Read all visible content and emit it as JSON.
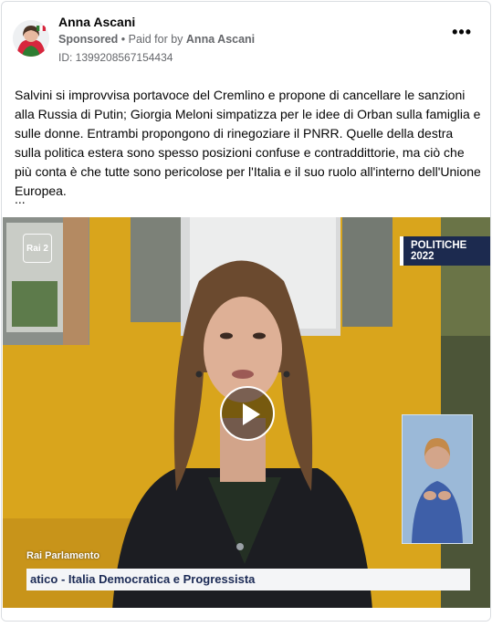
{
  "post": {
    "author": "Anna Ascani",
    "sponsored_label": "Sponsored",
    "separator": "•",
    "paid_for_prefix": "Paid for by",
    "paid_for_name": "Anna Ascani",
    "ad_id": "ID: 1399208567154434",
    "more_icon": "more-horizontal-icon",
    "more_glyph": "•••",
    "text": "Salvini si improvvisa portavoce del Cremlino e propone di cancellare le sanzioni alla Russia di Putin; Giorgia Meloni simpatizza per le idee di Orban sulla famiglia e sulle donne. Entrambi propongono di rinegoziare il PNRR. Quelle della destra sulla politica estera sono spesso posizioni confuse e contraddittorie, ma ciò che più conta è che tutte sono pericolose per l'Italia e il suo ruolo all'interno dell'Unione Europea.",
    "truncation": "..."
  },
  "video": {
    "badge": "POLITICHE 2022",
    "channel_logo": "Rai 2",
    "lower_third_tag": "Rai Parlamento",
    "lower_third_title": "atico - Italia Democratica e Progressista",
    "play_icon": "play-icon",
    "colors": {
      "wall": "#d9a51c",
      "badge_bg": "#1c2a4f",
      "lower_third_text": "#1b2a55"
    }
  }
}
